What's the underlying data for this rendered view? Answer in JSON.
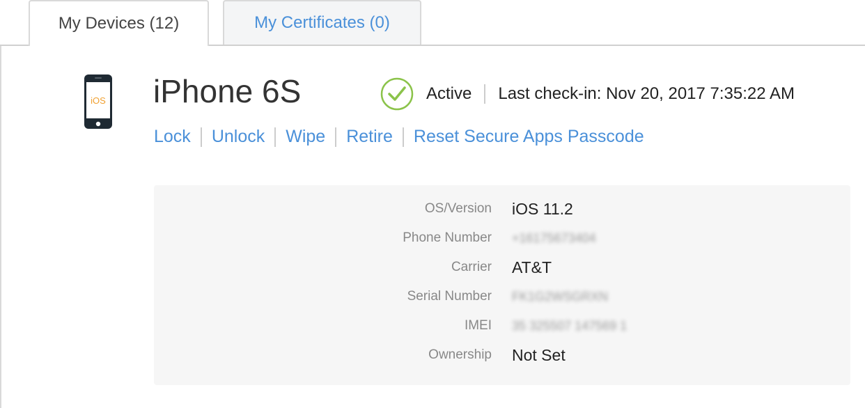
{
  "tabs": [
    {
      "label": "My Devices (12)",
      "active": true
    },
    {
      "label": "My Certificates (0)",
      "active": false
    }
  ],
  "device": {
    "name": "iPhone 6S",
    "platform_badge": "iOS",
    "icon": "iphone-icon"
  },
  "status": {
    "label": "Active",
    "icon": "check-circle-icon",
    "last_checkin": "Last check-in: Nov 20, 2017 7:35:22 AM"
  },
  "actions": [
    {
      "label": "Lock"
    },
    {
      "label": "Unlock"
    },
    {
      "label": "Wipe"
    },
    {
      "label": "Retire"
    },
    {
      "label": "Reset Secure Apps Passcode"
    }
  ],
  "details": [
    {
      "label": "OS/Version",
      "value": "iOS 11.2",
      "blurred": false
    },
    {
      "label": "Phone Number",
      "value": "+16175673404",
      "blurred": true
    },
    {
      "label": "Carrier",
      "value": "AT&T",
      "blurred": false
    },
    {
      "label": "Serial Number",
      "value": "FK1G2WSGRXN",
      "blurred": true
    },
    {
      "label": "IMEI",
      "value": "35 325507 147569 1",
      "blurred": true
    },
    {
      "label": "Ownership",
      "value": "Not Set",
      "blurred": false
    }
  ],
  "colors": {
    "link": "#4a90d9",
    "check": "#8bc34a",
    "ios_badge": "#f0a030",
    "panel_bg": "#f6f6f6"
  }
}
